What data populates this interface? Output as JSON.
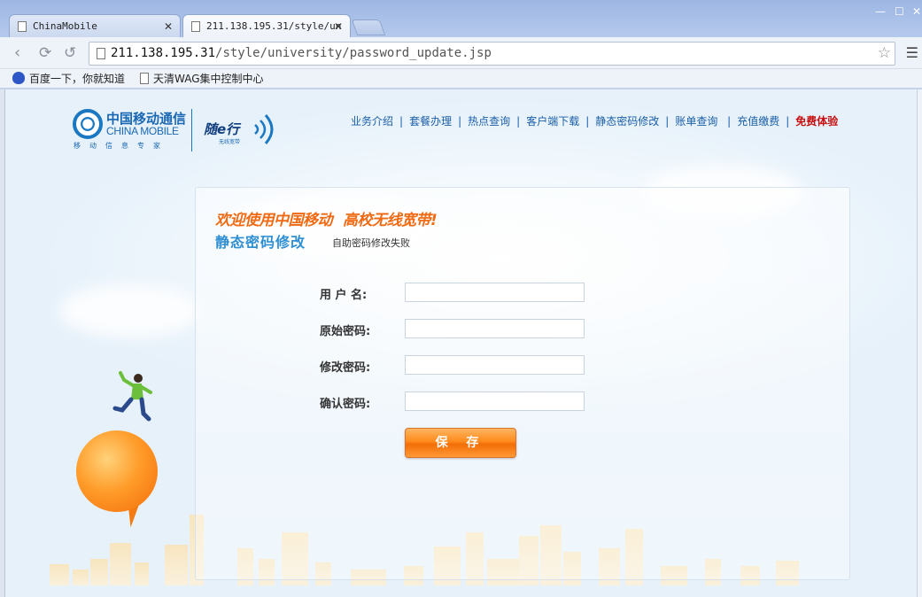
{
  "browser": {
    "tabs": [
      {
        "label": "ChinaMobile",
        "active": false
      },
      {
        "label": "211.138.195.31/style/un",
        "active": true
      }
    ],
    "url_host": "211.138.195.31",
    "url_path": "/style/university/password_update.jsp",
    "bookmarks": [
      {
        "label": "百度一下，你就知道",
        "icon": "baidu-paw-icon"
      },
      {
        "label": "天清WAG集中控制中心",
        "icon": "page-icon"
      }
    ]
  },
  "header": {
    "logo_cn": "中国移动通信",
    "logo_en": "CHINA MOBILE",
    "logo_slogan": "移动信息专家",
    "sub_logo": "随e行",
    "sub_logo_caption": "无线宽带",
    "nav": [
      {
        "label": "业务介绍",
        "highlight": false
      },
      {
        "label": "套餐办理",
        "highlight": false
      },
      {
        "label": "热点查询",
        "highlight": false
      },
      {
        "label": "客户端下载",
        "highlight": false
      },
      {
        "label": "静态密码修改",
        "highlight": false
      },
      {
        "label": "账单查询",
        "highlight": false
      },
      {
        "label": "充值缴费",
        "highlight": false
      },
      {
        "label": "免费体验",
        "highlight": true
      }
    ]
  },
  "panel": {
    "welcome_part1": "欢迎使用中国移动",
    "welcome_part2": "高校无线宽带!",
    "section_title": "静态密码修改",
    "status_message": "自助密码修改失败",
    "fields": [
      {
        "label": "用 户 名:",
        "value": ""
      },
      {
        "label": "原始密码:",
        "value": ""
      },
      {
        "label": "修改密码:",
        "value": ""
      },
      {
        "label": "确认密码:",
        "value": ""
      }
    ],
    "save_label": "保 存"
  },
  "colors": {
    "accent_orange": "#f06a13",
    "link_blue": "#1a5ea8",
    "title_blue": "#2f8fd2",
    "highlight_red": "#c70f0f"
  }
}
